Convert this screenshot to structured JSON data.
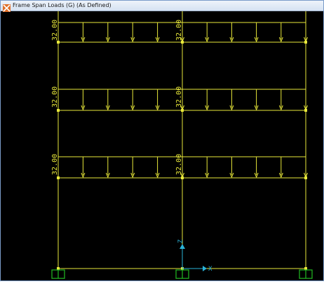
{
  "window": {
    "title": "Frame Span Loads (G) (As Defined)",
    "icon": "app-icon"
  },
  "colors": {
    "frame": "#e8e83a",
    "background": "#000000",
    "support": "#22bb22",
    "axis": "#2ab3d8"
  },
  "axes": {
    "x_label": "X",
    "z_label": "Z"
  },
  "load_value": "32.00",
  "floors": [
    {
      "labels": [
        "32.00",
        "32.00"
      ]
    },
    {
      "labels": [
        "32.00",
        "32.00"
      ]
    },
    {
      "labels": [
        "32.00",
        "32.00"
      ]
    }
  ]
}
